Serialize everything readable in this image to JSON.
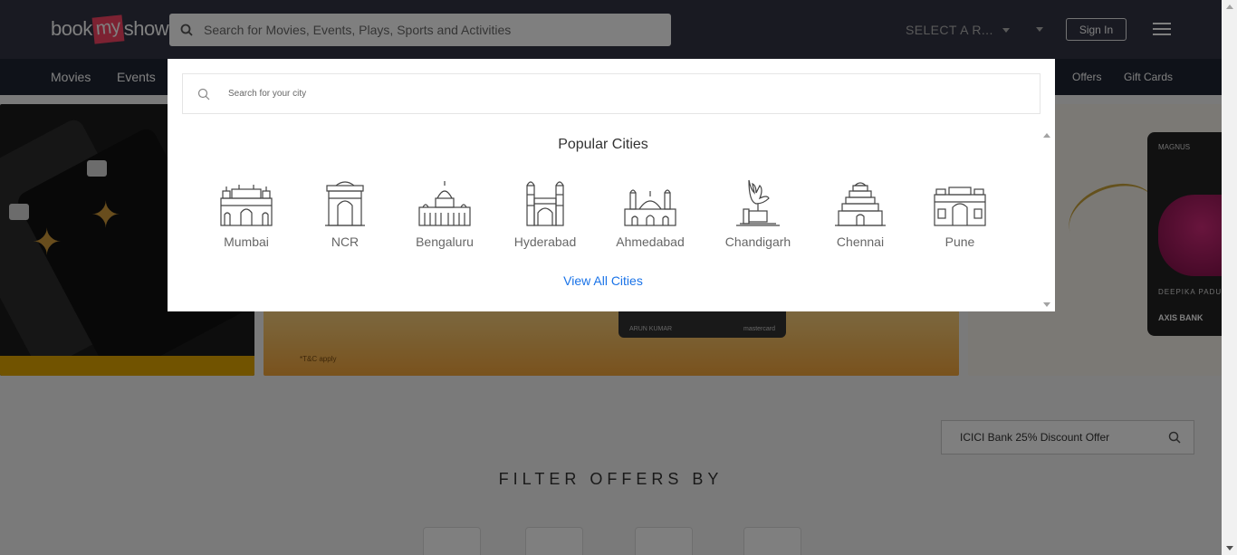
{
  "header": {
    "logo": {
      "part1": "book",
      "part2": "my",
      "part3": "show"
    },
    "search_placeholder": "Search for Movies, Events, Plays, Sports and Activities",
    "city_select": "SELECT A R...",
    "sign_in": "Sign In",
    "colors": {
      "topbar": "#333545",
      "navbar": "#1f2533",
      "brand": "#f84464"
    }
  },
  "nav": {
    "left": [
      "Movies",
      "Events"
    ],
    "right": [
      "Offers",
      "Gift Cards"
    ]
  },
  "banners": {
    "tc_note": "*T&C apply",
    "card_holder": "ARUN KUMAR",
    "card_brand": "mastercard",
    "magnus_label": "MAGNUS",
    "card_name": "DEEPIKA PADU",
    "bank": "AXIS BANK"
  },
  "offers": {
    "search_value": "ICICI Bank 25% Discount Offer",
    "filter_heading": "FILTER OFFERS BY"
  },
  "city_modal": {
    "search_placeholder": "Search for your city",
    "popular_title": "Popular Cities",
    "cities": [
      {
        "name": "Mumbai",
        "icon": "gateway-of-india-icon"
      },
      {
        "name": "NCR",
        "icon": "india-gate-icon"
      },
      {
        "name": "Bengaluru",
        "icon": "vidhana-soudha-icon"
      },
      {
        "name": "Hyderabad",
        "icon": "charminar-icon"
      },
      {
        "name": "Ahmedabad",
        "icon": "mosque-icon"
      },
      {
        "name": "Chandigarh",
        "icon": "open-hand-monument-icon"
      },
      {
        "name": "Chennai",
        "icon": "temple-gopuram-icon"
      },
      {
        "name": "Pune",
        "icon": "shaniwar-wada-icon"
      }
    ],
    "view_all": "View All Cities",
    "link_color": "#1a73e8"
  }
}
